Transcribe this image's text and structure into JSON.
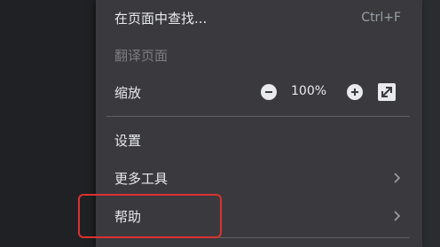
{
  "menu": {
    "find": {
      "label": "在页面中查找...",
      "shortcut": "Ctrl+F"
    },
    "translate": {
      "label": "翻译页面",
      "disabled": true
    },
    "zoom": {
      "label": "缩放",
      "value": "100%",
      "minus_icon": "minus-circle-icon",
      "plus_icon": "plus-circle-icon",
      "fullscreen_icon": "fullscreen-icon"
    },
    "settings": {
      "label": "设置"
    },
    "more_tools": {
      "label": "更多工具",
      "icon": "chevron-right-icon"
    },
    "help": {
      "label": "帮助",
      "icon": "chevron-right-icon"
    }
  },
  "annotation": {
    "highlight_color": "#d9322f"
  },
  "colors": {
    "menu_bg": "#3a393e",
    "text": "#e8eaed",
    "disabled_text": "#7d7c80",
    "page_bg": "#202124"
  }
}
